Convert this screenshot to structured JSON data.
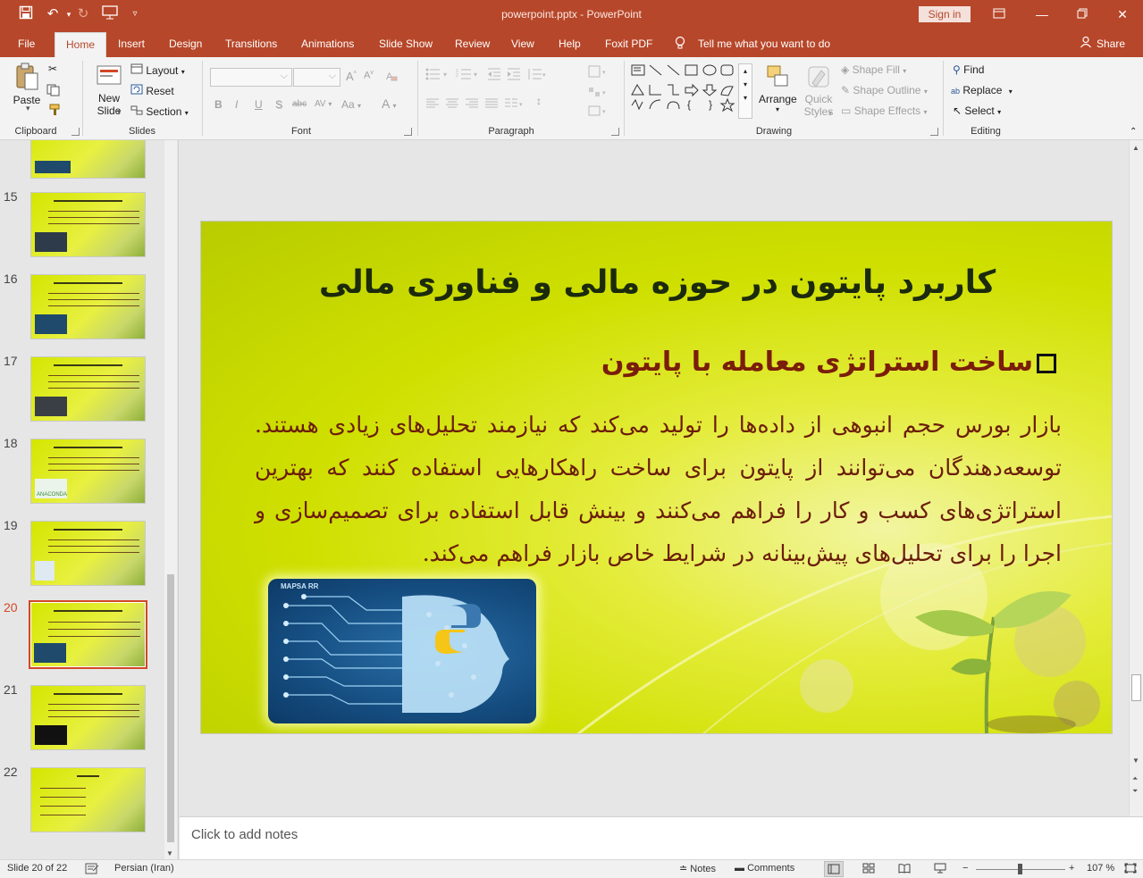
{
  "window": {
    "title": "powerpoint.pptx  -  PowerPoint",
    "signin_label": "Sign in"
  },
  "tabs": [
    "File",
    "Home",
    "Insert",
    "Design",
    "Transitions",
    "Animations",
    "Slide Show",
    "Review",
    "View",
    "Help",
    "Foxit PDF"
  ],
  "tell_me": "Tell me what you want to do",
  "share_label": "Share",
  "ribbon": {
    "clipboard": {
      "paste": "Paste",
      "label": "Clipboard"
    },
    "slides": {
      "new_slide_1": "New",
      "new_slide_2": "Slide",
      "layout": "Layout",
      "reset": "Reset",
      "section": "Section",
      "label": "Slides"
    },
    "font": {
      "label": "Font",
      "bold": "B",
      "italic": "I",
      "underline": "U",
      "strike": "S",
      "abc": "abc",
      "av": "AV",
      "aa": "Aa",
      "a": "A"
    },
    "paragraph": {
      "label": "Paragraph"
    },
    "drawing": {
      "arrange": "Arrange",
      "quick_1": "Quick",
      "quick_2": "Styles",
      "shape_fill": "Shape Fill",
      "shape_outline": "Shape Outline",
      "shape_effects": "Shape Effects",
      "label": "Drawing"
    },
    "editing": {
      "find": "Find",
      "replace": "Replace",
      "select": "Select",
      "label": "Editing"
    }
  },
  "thumbnails": [
    {
      "num": "15"
    },
    {
      "num": "16"
    },
    {
      "num": "17"
    },
    {
      "num": "18",
      "logo": "ANACONDA"
    },
    {
      "num": "19"
    },
    {
      "num": "20",
      "selected": true
    },
    {
      "num": "21"
    },
    {
      "num": "22"
    }
  ],
  "slide": {
    "title": "کاربرد پایتون در حوزه مالی و فناوری مالی",
    "subtitle": "ساخت استراتژی معامله با پایتون",
    "body": "بازار بورس حجم انبوهی از داده‌ها را تولید می‌کند که نیازمند تحلیل‌های زیادی هستند. توسعه‌دهندگان می‌توانند از پایتون برای ساخت راهکارهایی استفاده کنند که بهترین استراتژی‌های کسب و کار را فراهم می‌کنند و بینش قابل استفاده برای تصمیم‌سازی و اجرا را برای تحلیل‌های پیش‌بینانه در شرایط خاص بازار فراهم می‌کند.",
    "image_label": "MAPSA RR"
  },
  "notes_placeholder": "Click to add notes",
  "status": {
    "slide_info": "Slide 20 of 22",
    "language": "Persian (Iran)",
    "notes": "Notes",
    "comments": "Comments",
    "zoom": "107 %"
  },
  "colors": {
    "accent": "#b7472a",
    "ribbon_bg": "#f3f3f3",
    "selected_thumb": "#d24726"
  }
}
